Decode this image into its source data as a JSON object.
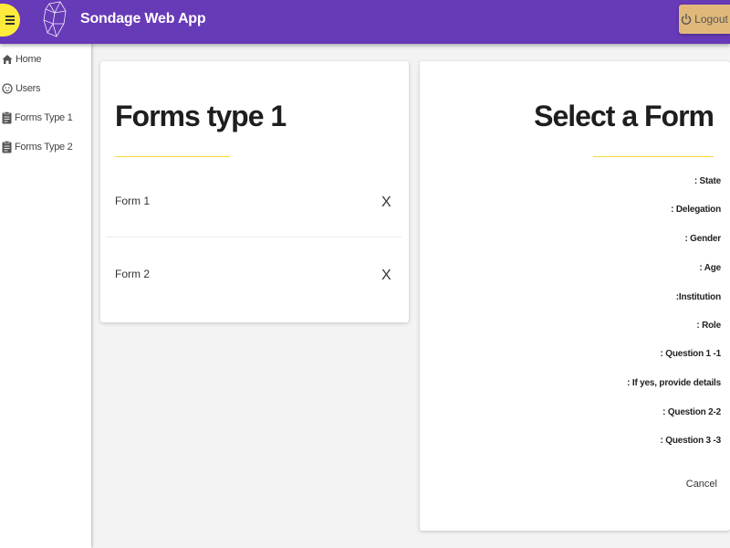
{
  "header": {
    "app_title": "Sondage Web App",
    "logout_label": "Logout",
    "accent_color": "#673ab7",
    "menu_button_color": "#ffeb3b",
    "logout_button_color": "#e0b97a"
  },
  "sidebar": {
    "items": [
      {
        "label": "Home",
        "icon": "home-icon"
      },
      {
        "label": "Users",
        "icon": "user-face-icon"
      },
      {
        "label": "Forms Type 1",
        "icon": "clipboard-icon"
      },
      {
        "label": "Forms Type 2",
        "icon": "clipboard-icon"
      }
    ]
  },
  "forms_panel": {
    "title": "Forms type 1",
    "forms": [
      {
        "name": "Form 1",
        "delete_label": "X"
      },
      {
        "name": "Form 2",
        "delete_label": "X"
      }
    ]
  },
  "detail_panel": {
    "title": "Select a Form",
    "fields": [
      ": State",
      ": Delegation",
      ": Gender",
      ": Age",
      ":Institution",
      ": Role",
      ": Question 1 -1",
      ": If yes, provide details",
      ": Question 2-2",
      ": Question 3 -3"
    ],
    "cancel_label": "Cancel"
  }
}
